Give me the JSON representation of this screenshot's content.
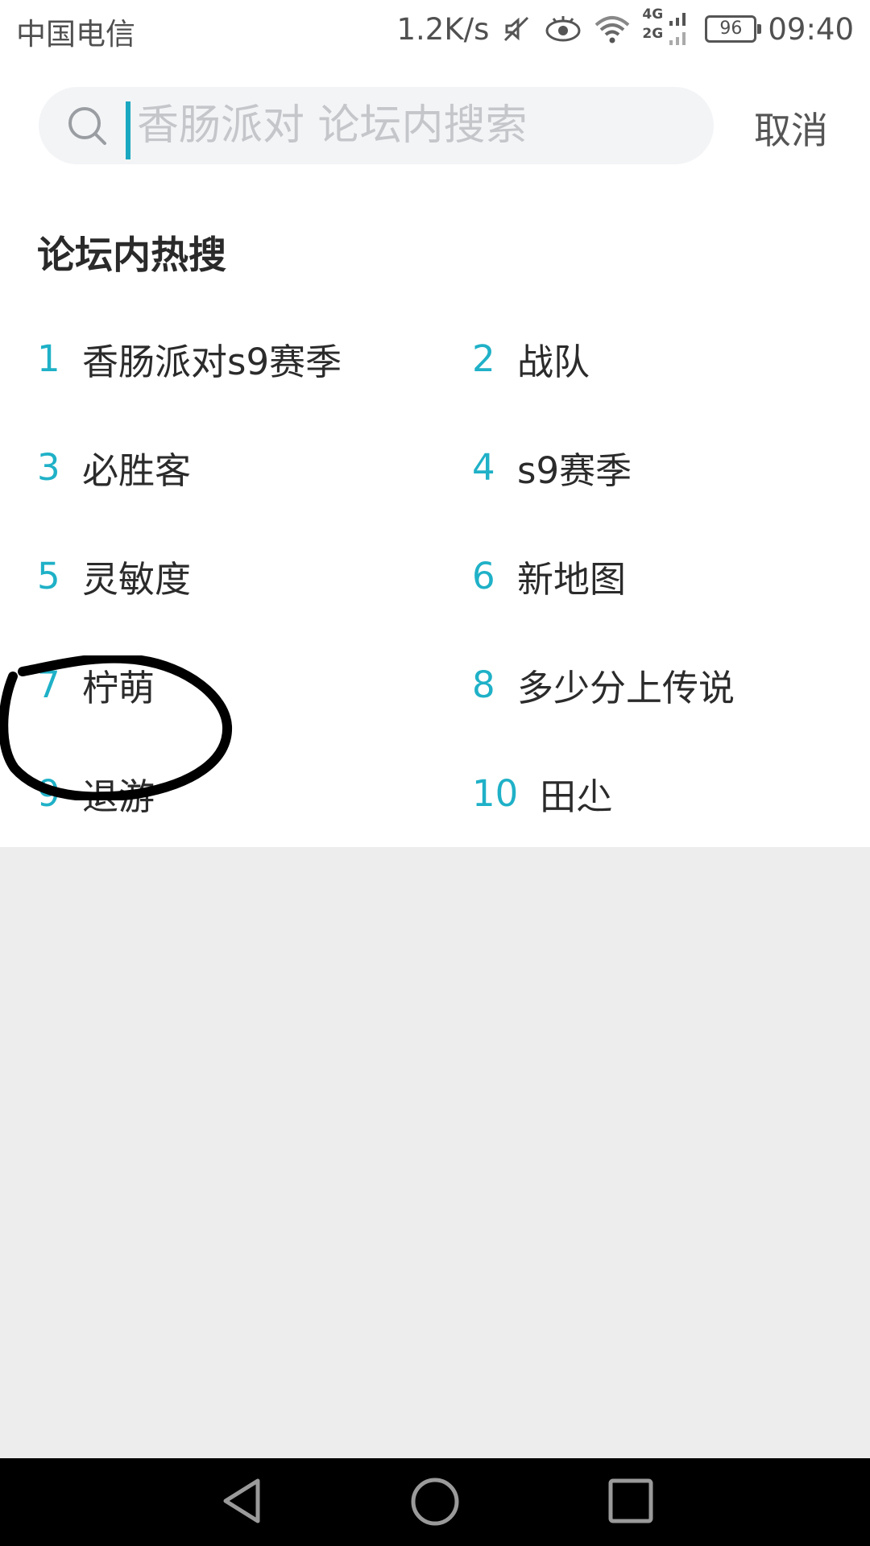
{
  "status_bar": {
    "carrier": "中国电信",
    "net_speed": "1.2K/s",
    "network_4g": "4G",
    "network_2g": "2G",
    "battery": "96",
    "time": "09:40"
  },
  "search": {
    "placeholder": "香肠派对 论坛内搜索",
    "cancel_label": "取消"
  },
  "hot_search": {
    "title": "论坛内热搜",
    "items": [
      {
        "rank": "1",
        "text": "香肠派对s9赛季"
      },
      {
        "rank": "2",
        "text": "战队"
      },
      {
        "rank": "3",
        "text": "必胜客"
      },
      {
        "rank": "4",
        "text": "s9赛季"
      },
      {
        "rank": "5",
        "text": "灵敏度"
      },
      {
        "rank": "6",
        "text": "新地图"
      },
      {
        "rank": "7",
        "text": "柠萌"
      },
      {
        "rank": "8",
        "text": "多少分上传说"
      },
      {
        "rank": "9",
        "text": "退游"
      },
      {
        "rank": "10",
        "text": "田尐"
      }
    ]
  },
  "colors": {
    "accent": "#1fb1c7",
    "background": "#ededed",
    "nav_bar": "#000000"
  },
  "icons": [
    "search-icon",
    "mute-icon",
    "eye-icon",
    "wifi-icon",
    "signal-icon",
    "battery-icon",
    "back-icon",
    "home-icon",
    "recents-icon"
  ]
}
